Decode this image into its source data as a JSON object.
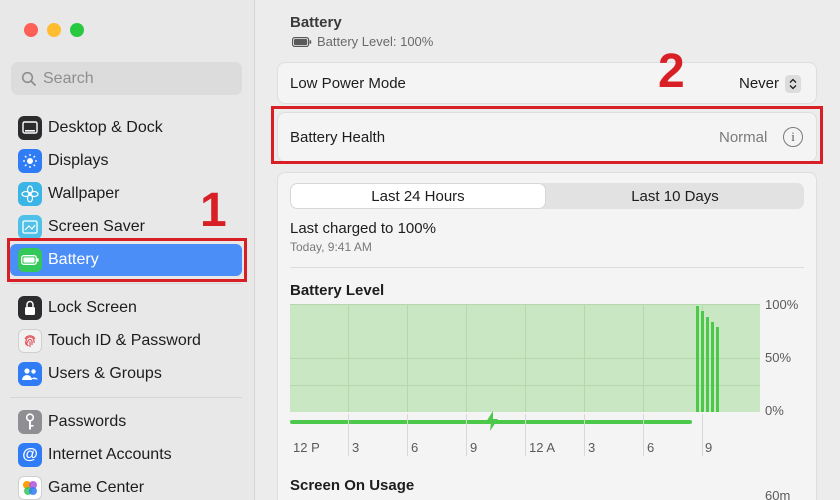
{
  "sidebar": {
    "search_placeholder": "Search",
    "items": [
      {
        "label": "Desktop & Dock",
        "icon": "desktop-dock-icon",
        "color": "#2c2c2e"
      },
      {
        "label": "Displays",
        "icon": "displays-icon",
        "color": "#2f7cf6"
      },
      {
        "label": "Wallpaper",
        "icon": "wallpaper-icon",
        "color": "#3ab5e6"
      },
      {
        "label": "Screen Saver",
        "icon": "screen-saver-icon",
        "color": "#4fc1e9"
      },
      {
        "label": "Battery",
        "icon": "battery-icon",
        "color": "#34c759",
        "selected": true
      },
      {
        "label": "Lock Screen",
        "icon": "lock-icon",
        "color": "#2c2c2e"
      },
      {
        "label": "Touch ID & Password",
        "icon": "fingerprint-icon",
        "color": "#f2f2f2"
      },
      {
        "label": "Users & Groups",
        "icon": "users-icon",
        "color": "#2f7cf6"
      },
      {
        "label": "Passwords",
        "icon": "key-icon",
        "color": "#8e8e93"
      },
      {
        "label": "Internet Accounts",
        "icon": "at-icon",
        "color": "#2f7cf6"
      },
      {
        "label": "Game Center",
        "icon": "game-center-icon",
        "color": "#ff9f0a"
      }
    ]
  },
  "annotations": {
    "one": "1",
    "two": "2",
    "color": "#d81f26"
  },
  "header": {
    "title": "Battery",
    "battery_level": "Battery Level: 100%"
  },
  "low_power": {
    "label": "Low Power Mode",
    "value": "Never"
  },
  "battery_health": {
    "label": "Battery Health",
    "value": "Normal"
  },
  "tabs": {
    "active": "Last 24 Hours",
    "inactive": "Last 10 Days"
  },
  "last_charged": {
    "title": "Last charged to 100%",
    "time": "Today, 9:41 AM"
  },
  "battery_level_section": {
    "title": "Battery Level"
  },
  "screen_usage_section": {
    "title": "Screen On Usage",
    "partial_label": "60m"
  },
  "chart_data": {
    "type": "bar",
    "title": "Battery Level",
    "x_tick_labels": [
      "12 P",
      "3",
      "6",
      "9",
      "12 A",
      "3",
      "6",
      "9"
    ],
    "y_tick_labels": [
      "100%",
      "50%",
      "0%"
    ],
    "ylim": [
      0,
      100
    ],
    "charging_indicator": "lightning-icon",
    "values": [
      100,
      95,
      90,
      85,
      80
    ],
    "colors": {
      "bar": "#4cc94a",
      "fill": "#c9e7c2"
    }
  }
}
